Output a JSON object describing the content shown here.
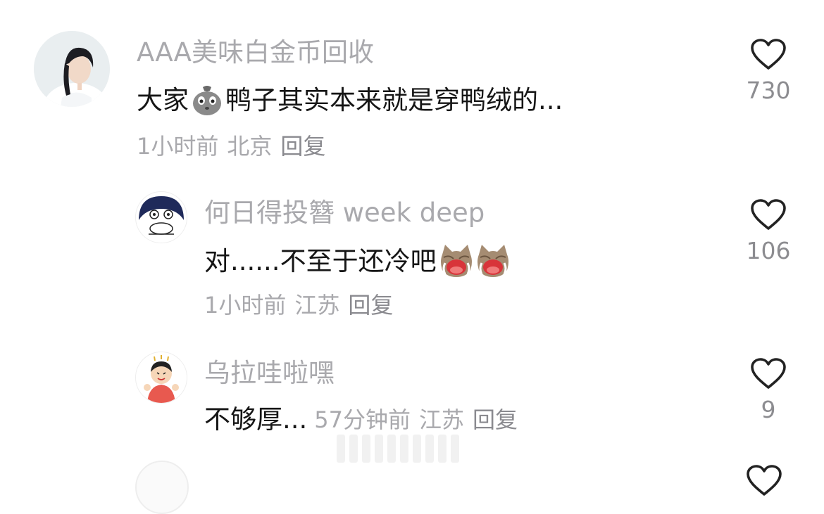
{
  "comments": [
    {
      "username": "AAA美味白金币回收",
      "text_before": "大家",
      "text_after": "鸭子其实本来就是穿鸭绒的...",
      "emoji": "sack-face-emoji",
      "time": "1小时前",
      "location": "北京",
      "reply_label": "回复",
      "likes": "730"
    },
    {
      "username": "何日得投簪 week deep",
      "text_before": "对......不至于还冷吧",
      "emoji": "crying-cat-emoji",
      "time": "1小时前",
      "location": "江苏",
      "reply_label": "回复",
      "likes": "106"
    },
    {
      "username": "乌拉哇啦嘿",
      "text_before": "不够厚...",
      "time": "57分钟前",
      "location": "江苏",
      "reply_label": "回复",
      "likes": "9"
    }
  ],
  "colors": {
    "username": "#a9a9ad",
    "text": "#161616",
    "meta": "#a9a9ad",
    "like_count": "#8c8c90"
  }
}
